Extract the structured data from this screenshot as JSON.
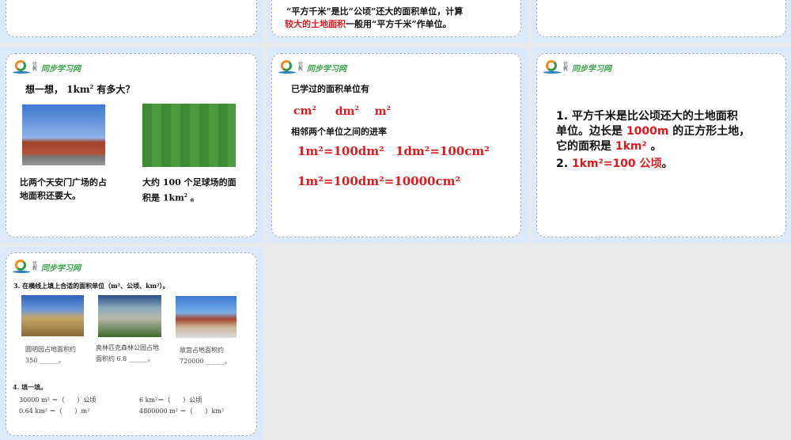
{
  "brand": {
    "small": "优教",
    "name": "同步学习网"
  },
  "slides": [
    {
      "id": "top-left"
    },
    {
      "id": "top-middle",
      "line1": "“平方千米”是比“公顷”还大的面积单位，计算",
      "line2_red": "较大的土地面积",
      "line2_rest": "一般用“平方千米”作单位。"
    },
    {
      "id": "top-right"
    },
    {
      "heading_pre": "想一想， 1km",
      "heading_post": " 有多大？",
      "sup": "2",
      "cap1_l1": "比两个天安门广场的占",
      "cap1_l2": "地面积还要大。",
      "cap2_l1": "大约 100 个足球场的面",
      "cap2_l2_pre": "积是 1km",
      "cap2_l2_post": " 。"
    },
    {
      "line1": "已学过的面积单位有",
      "units": [
        "cm",
        "dm",
        "m"
      ],
      "line2": "相邻两个单位之间的进率",
      "eq1": "1m²=100dm²",
      "eq2": "1dm²=100cm²",
      "eq3": "1m²=100dm²=10000cm²"
    },
    {
      "p1_a": "1. 平方千米是比公顷还大的土地面积",
      "p1_b_pre": "单位。边长是 ",
      "p1_b_red": "1000m",
      "p1_b_post": " 的正方形土地，",
      "p1_c_pre": "它的面积是 ",
      "p1_c_red": "1km²",
      "p1_c_post": " 。",
      "p2_pre": "2. ",
      "p2_red": "1km²=100 公顷",
      "p2_post": "。"
    },
    {
      "q3": "3. 在横线上填上合适的面积单位（m²、公顷、km²）。",
      "c1a": "圆明园占地面积约",
      "c1b": "350 ______。",
      "c2a": "奥林匹克森林公园占地",
      "c2b": "面积约 6.8 ______。",
      "c3a": "故宫占地面积约",
      "c3b": "720000 ______。",
      "q4": "4. 填一填。",
      "f1": "30000 m² ＝（　　）公顷",
      "f2": "6 km²＝（　　）公顷",
      "f3": "0.64 km² ＝（　　）m²",
      "f4": "4800000 m² ＝（　　）km²"
    }
  ],
  "colors": {
    "accent_red": "#e0191e",
    "tile": "#dce9fb",
    "brand_green": "#3aa24a"
  }
}
